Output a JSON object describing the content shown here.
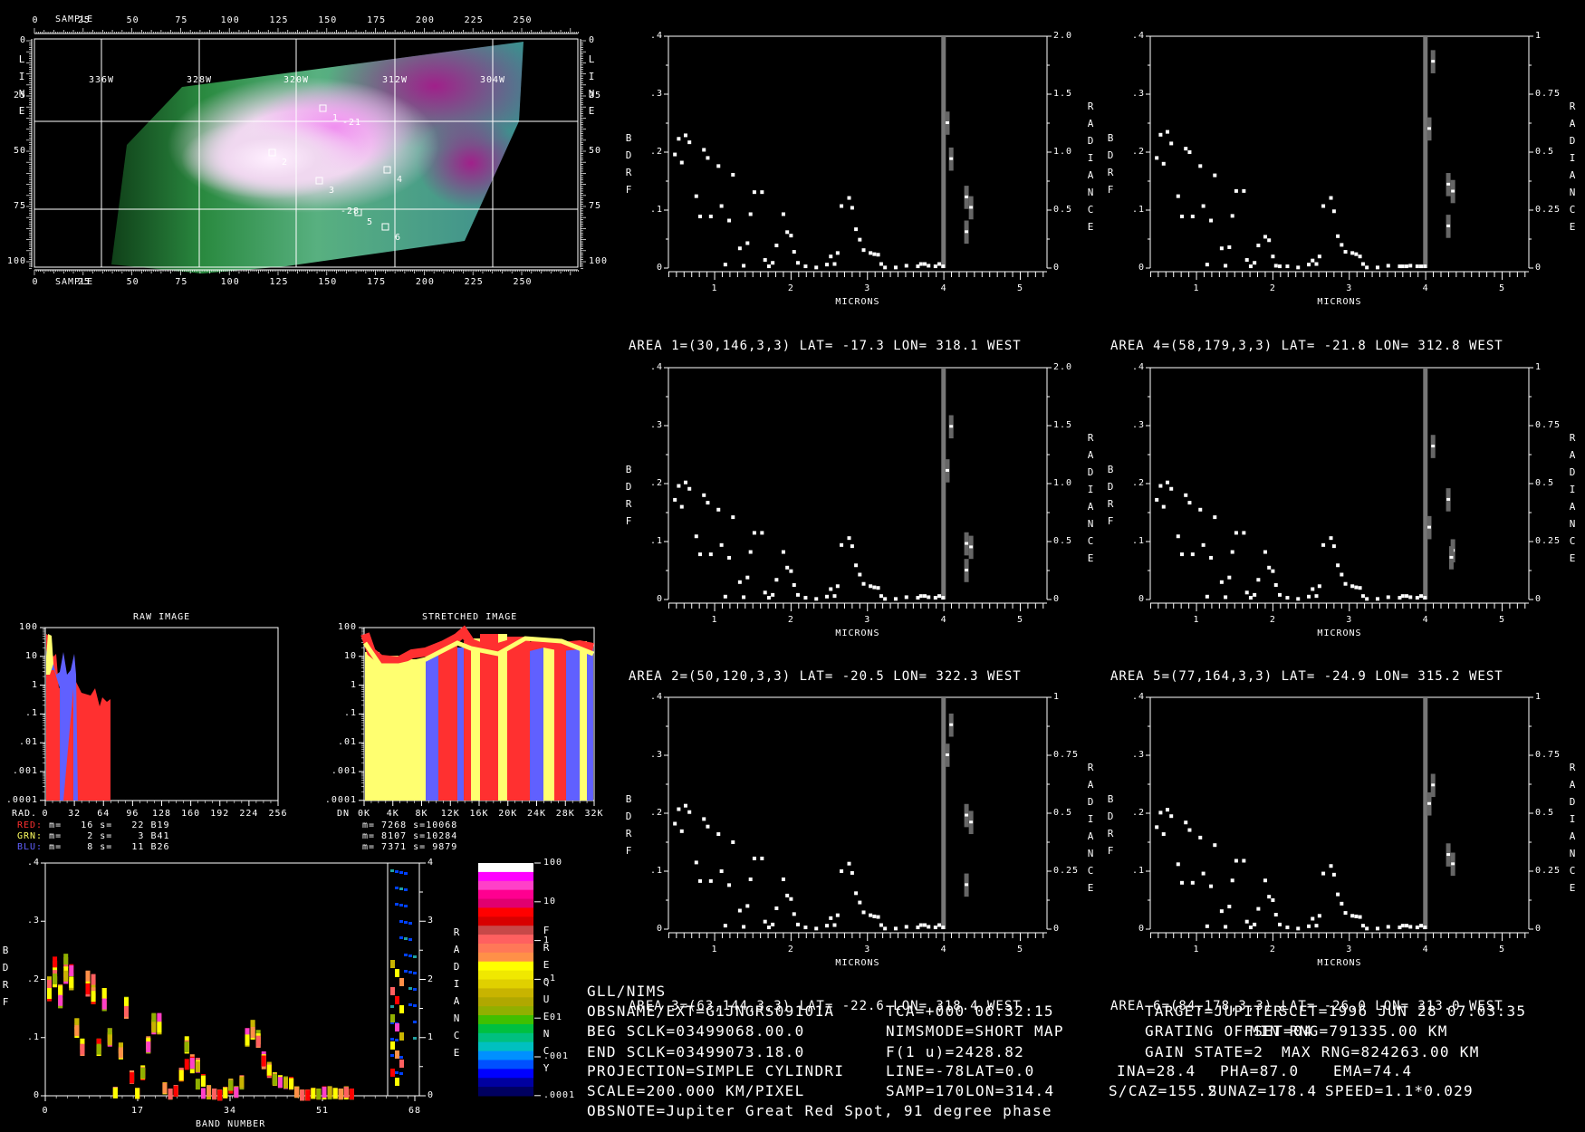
{
  "image_panel": {
    "sample_label": "SAMPLE",
    "line_label": "LINE",
    "sample_ticks": [
      "0",
      "25",
      "50",
      "75",
      "100",
      "125",
      "150",
      "175",
      "200",
      "225",
      "250"
    ],
    "line_ticks": [
      "0",
      "25",
      "50",
      "75",
      "100"
    ],
    "lon_labels": [
      "336W",
      "328W",
      "320W",
      "312W",
      "304W"
    ],
    "area_markers": [
      "1",
      "2",
      "3",
      "4",
      "5",
      "6"
    ],
    "lat_labels": [
      "-21",
      "-28"
    ]
  },
  "raw_hist": {
    "title": "RAW IMAGE",
    "y_ticks": [
      "100",
      "10",
      "1",
      ".1",
      ".01",
      ".001",
      ".0001"
    ],
    "x_label": "RAD.",
    "x_ticks": [
      "0",
      "32",
      "64",
      "96",
      "128",
      "160",
      "192",
      "224",
      "256"
    ],
    "stats": [
      {
        "label": "RED:",
        "text": " m=   16 s=   22 B19",
        "color": "#ff3030"
      },
      {
        "label": "GRN:",
        "text": " m=    2 s=    3 B41",
        "color": "#ffff60"
      },
      {
        "label": "BLU:",
        "text": " m=    8 s=   11 B26",
        "color": "#6060ff"
      }
    ]
  },
  "stretched_hist": {
    "title": "STRETCHED IMAGE",
    "y_ticks": [
      "100",
      "10",
      "1",
      ".1",
      ".01",
      ".001",
      ".0001"
    ],
    "x_label": "DN",
    "x_ticks": [
      "0K",
      "4K",
      "8K",
      "12K",
      "16K",
      "20K",
      "24K",
      "28K",
      "32K"
    ],
    "stats": [
      "m= 7268 s=10068",
      "m= 8107 s=10284",
      "m= 7371 s= 9879"
    ]
  },
  "band_plot": {
    "y_label": "BDRF",
    "y_ticks": [
      ".4",
      ".3",
      ".2",
      ".1",
      "0"
    ],
    "r_label": "RADIANCE",
    "r_ticks": [
      "4",
      "3",
      "2",
      "1",
      "0"
    ],
    "x_label": "BAND NUMBER",
    "x_ticks": [
      "0",
      "17",
      "34",
      "51",
      "68"
    ]
  },
  "color_scale": {
    "label": "FREQUENCY",
    "ticks": [
      "100",
      "10",
      "1",
      ".1",
      ".01",
      ".001",
      ".0001"
    ],
    "colors": [
      "#ffffff",
      "#ff00ff",
      "#ff40c8",
      "#ff0090",
      "#e00070",
      "#ff0000",
      "#d80000",
      "#c84848",
      "#ff6060",
      "#ff7858",
      "#ff9048",
      "#ffff00",
      "#f0e800",
      "#e0d000",
      "#c8b400",
      "#b0a800",
      "#90b000",
      "#40c000",
      "#00c040",
      "#00c080",
      "#00c0c0",
      "#0090ff",
      "#0050ff",
      "#0000ff",
      "#0000a0",
      "#000060"
    ]
  },
  "chart_data": {
    "type": "scatter",
    "xlabel": "MICRONS",
    "ylabel": "BDRF",
    "rlabel": "RADIANCE",
    "xlim": [
      0.395,
      5.35
    ],
    "ylim": [
      0,
      0.4
    ],
    "x_ticks": [
      "1",
      "2",
      "3",
      "4",
      "5"
    ],
    "y_ticks": [
      ".4",
      ".3",
      ".2",
      ".1",
      "0"
    ],
    "x": [
      0.48,
      0.53,
      0.57,
      0.62,
      0.67,
      0.76,
      0.81,
      0.86,
      0.91,
      0.95,
      1.05,
      1.09,
      1.14,
      1.19,
      1.24,
      1.33,
      1.38,
      1.43,
      1.47,
      1.52,
      1.62,
      1.66,
      1.71,
      1.76,
      1.81,
      1.9,
      1.95,
      2.0,
      2.04,
      2.09,
      2.19,
      2.33,
      2.47,
      2.52,
      2.57,
      2.61,
      2.66,
      2.76,
      2.8,
      2.85,
      2.9,
      2.95,
      3.04,
      3.09,
      3.14,
      3.18,
      3.23,
      3.37,
      3.51,
      3.66,
      3.7,
      3.75,
      3.8,
      3.89,
      3.94,
      3.99
    ],
    "areas": [
      {
        "title": "AREA 1=(30,146,3,3) LAT= -17.3 LON= 318.1 WEST",
        "rmax": 2.0,
        "r_ticks": [
          "2.0",
          "1.5",
          "1.0",
          "0.5",
          "0"
        ],
        "bdrf": [
          0.196,
          0.223,
          0.182,
          0.229,
          0.217,
          0.124,
          0.089,
          0.204,
          0.19,
          0.089,
          0.176,
          0.107,
          0.006,
          0.082,
          0.161,
          0.034,
          0.004,
          0.043,
          0.093,
          0.131,
          0.131,
          0.014,
          0.003,
          0.009,
          0.039,
          0.093,
          0.062,
          0.056,
          0.028,
          0.009,
          0.003,
          0.001,
          0.006,
          0.02,
          0.007,
          0.026,
          0.107,
          0.121,
          0.104,
          0.067,
          0.049,
          0.031,
          0.026,
          0.024,
          0.023,
          0.007,
          0.001,
          0.001,
          0.004,
          0.003,
          0.007,
          0.007,
          0.004,
          0.003,
          0.007,
          0.003
        ],
        "radiance": [
          {
            "x": 4.04,
            "y": 1.25
          },
          {
            "x": 4.09,
            "y": 0.94
          },
          {
            "x": 4.29,
            "y": 0.61
          },
          {
            "x": 4.35,
            "y": 0.52
          },
          {
            "x": 4.29,
            "y": 0.31
          }
        ]
      },
      {
        "title": "AREA 2=(50,120,3,3) LAT= -20.5 LON= 322.3 WEST",
        "rmax": 2.0,
        "r_ticks": [
          "2.0",
          "1.5",
          "1.0",
          "0.5",
          "0"
        ],
        "bdrf": [
          0.172,
          0.196,
          0.16,
          0.202,
          0.191,
          0.109,
          0.078,
          0.18,
          0.167,
          0.078,
          0.155,
          0.094,
          0.005,
          0.072,
          0.142,
          0.03,
          0.004,
          0.038,
          0.082,
          0.115,
          0.115,
          0.012,
          0.003,
          0.008,
          0.034,
          0.082,
          0.055,
          0.049,
          0.025,
          0.008,
          0.003,
          0.001,
          0.005,
          0.018,
          0.006,
          0.023,
          0.094,
          0.106,
          0.092,
          0.059,
          0.043,
          0.027,
          0.023,
          0.021,
          0.02,
          0.006,
          0.001,
          0.001,
          0.004,
          0.003,
          0.006,
          0.006,
          0.004,
          0.003,
          0.006,
          0.003
        ],
        "radiance": [
          {
            "x": 4.04,
            "y": 1.11
          },
          {
            "x": 4.09,
            "y": 1.49
          },
          {
            "x": 4.29,
            "y": 0.48
          },
          {
            "x": 4.35,
            "y": 0.45
          },
          {
            "x": 4.29,
            "y": 0.25
          }
        ]
      },
      {
        "title": "AREA 3=(63,144,3,3) LAT= -22.6 LON= 318.4 WEST",
        "rmax": 1.0,
        "r_ticks": [
          "1",
          "0.75",
          "0.5",
          "0.25",
          "0"
        ],
        "bdrf": [
          0.182,
          0.207,
          0.169,
          0.213,
          0.202,
          0.115,
          0.083,
          0.19,
          0.177,
          0.083,
          0.164,
          0.1,
          0.006,
          0.076,
          0.15,
          0.032,
          0.004,
          0.04,
          0.086,
          0.122,
          0.122,
          0.013,
          0.003,
          0.008,
          0.036,
          0.086,
          0.058,
          0.052,
          0.026,
          0.008,
          0.003,
          0.001,
          0.006,
          0.019,
          0.007,
          0.024,
          0.1,
          0.113,
          0.097,
          0.062,
          0.046,
          0.029,
          0.024,
          0.022,
          0.021,
          0.007,
          0.001,
          0.001,
          0.004,
          0.003,
          0.007,
          0.007,
          0.004,
          0.003,
          0.007,
          0.003
        ],
        "radiance": [
          {
            "x": 4.04,
            "y": 0.75
          },
          {
            "x": 4.09,
            "y": 0.88
          },
          {
            "x": 4.29,
            "y": 0.49
          },
          {
            "x": 4.35,
            "y": 0.46
          },
          {
            "x": 4.29,
            "y": 0.19
          }
        ]
      },
      {
        "title": "AREA 4=(58,179,3,3) LAT= -21.8 LON= 312.8 WEST",
        "rmax": 1.0,
        "r_ticks": [
          "1",
          "0.75",
          "0.5",
          "0.25",
          "0"
        ],
        "bdrf": [
          0.19,
          0.23,
          0.18,
          0.235,
          0.215,
          0.124,
          0.089,
          0.206,
          0.2,
          0.089,
          0.176,
          0.107,
          0.006,
          0.082,
          0.16,
          0.034,
          0.004,
          0.036,
          0.09,
          0.133,
          0.133,
          0.014,
          0.003,
          0.009,
          0.039,
          0.054,
          0.048,
          0.02,
          0.004,
          0.003,
          0.003,
          0.001,
          0.006,
          0.013,
          0.007,
          0.02,
          0.107,
          0.121,
          0.098,
          0.055,
          0.04,
          0.028,
          0.026,
          0.024,
          0.02,
          0.007,
          0.001,
          0.001,
          0.004,
          0.003,
          0.003,
          0.003,
          0.004,
          0.003,
          0.003,
          0.003
        ],
        "radiance": [
          {
            "x": 4.04,
            "y": 0.6
          },
          {
            "x": 4.09,
            "y": 0.89
          },
          {
            "x": 4.29,
            "y": 0.36
          },
          {
            "x": 4.35,
            "y": 0.33
          },
          {
            "x": 4.29,
            "y": 0.18
          }
        ]
      },
      {
        "title": "AREA 5=(77,164,3,3) LAT= -24.9 LON= 315.2 WEST",
        "rmax": 1.0,
        "r_ticks": [
          "1",
          "0.75",
          "0.5",
          "0.25",
          "0"
        ],
        "bdrf": [
          0.172,
          0.196,
          0.16,
          0.202,
          0.191,
          0.109,
          0.078,
          0.18,
          0.167,
          0.078,
          0.155,
          0.094,
          0.005,
          0.072,
          0.142,
          0.03,
          0.004,
          0.038,
          0.082,
          0.115,
          0.115,
          0.012,
          0.003,
          0.008,
          0.034,
          0.082,
          0.055,
          0.049,
          0.025,
          0.008,
          0.003,
          0.001,
          0.005,
          0.018,
          0.006,
          0.023,
          0.094,
          0.106,
          0.092,
          0.059,
          0.043,
          0.027,
          0.023,
          0.021,
          0.02,
          0.006,
          0.001,
          0.001,
          0.004,
          0.003,
          0.006,
          0.006,
          0.004,
          0.003,
          0.006,
          0.003
        ],
        "radiance": [
          {
            "x": 4.04,
            "y": 0.31
          },
          {
            "x": 4.09,
            "y": 0.66
          },
          {
            "x": 4.29,
            "y": 0.43
          },
          {
            "x": 4.35,
            "y": 0.21
          },
          {
            "x": 4.33,
            "y": 0.18
          }
        ]
      },
      {
        "title": "AREA 6=(84,178,3,3) LAT= -26.0 LON= 313.0 WEST",
        "rmax": 1.0,
        "r_ticks": [
          "1",
          "0.75",
          "0.5",
          "0.25",
          "0"
        ],
        "bdrf": [
          0.176,
          0.201,
          0.164,
          0.206,
          0.195,
          0.112,
          0.08,
          0.184,
          0.171,
          0.08,
          0.158,
          0.096,
          0.005,
          0.074,
          0.145,
          0.031,
          0.004,
          0.039,
          0.084,
          0.118,
          0.118,
          0.013,
          0.003,
          0.008,
          0.035,
          0.084,
          0.056,
          0.05,
          0.025,
          0.008,
          0.003,
          0.001,
          0.005,
          0.018,
          0.006,
          0.023,
          0.096,
          0.109,
          0.094,
          0.06,
          0.044,
          0.028,
          0.023,
          0.022,
          0.021,
          0.006,
          0.001,
          0.001,
          0.004,
          0.003,
          0.006,
          0.006,
          0.004,
          0.003,
          0.006,
          0.003
        ],
        "radiance": [
          {
            "x": 4.04,
            "y": 0.54
          },
          {
            "x": 4.09,
            "y": 0.62
          },
          {
            "x": 4.29,
            "y": 0.32
          },
          {
            "x": 4.35,
            "y": 0.28
          }
        ]
      }
    ]
  },
  "info": {
    "instrument": "GLL/NIMS",
    "obsname": "OBSNAME/EXT=G1JNGRS09101A",
    "beg_sclk": "BEG SCLK=03499068.00.0",
    "end_sclk": "END SCLK=03499073.18.0",
    "projection": "PROJECTION=SIMPLE CYLINDRI",
    "scale": "SCALE=200.000 KM/PIXEL",
    "obsnote": "OBSNOTE=Jupiter Great Red Spot, 91 degree phase",
    "tca": "TCA=+000 06:32:15",
    "nimsmode": "NIMSMODE=SHORT MAP",
    "f1u": "F(1 u)=2428.82",
    "line": "LINE=-78",
    "lat": "LAT=0.0",
    "samp": "SAMP=170",
    "lon": "LON=314.4",
    "target": "TARGET=JUPITER",
    "scet": "SCET=1996 JUN 28 07:03:35",
    "grating": "GRATING OFFSET=04",
    "min_rng": "MIN RNG=791335.00 KM",
    "gain": "GAIN STATE=2",
    "max_rng": "MAX RNG=824263.00 KM",
    "ina": "INA=28.4",
    "pha": "PHA=87.0",
    "ema": "EMA=74.4",
    "scaz": "S/CAZ=155.2",
    "sunaz": "SUNAZ=178.4",
    "speed": "SPEED=1.1*0.029"
  }
}
